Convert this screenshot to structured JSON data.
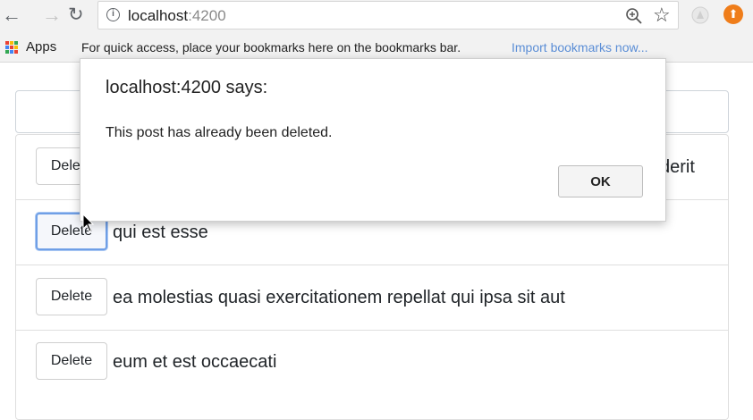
{
  "browser": {
    "url_host": "localhost",
    "url_port": ":4200",
    "apps_label": "Apps",
    "bookmarks_hint": "For quick access, place your bookmarks here on the bookmarks bar.",
    "import_link": "Import bookmarks now..."
  },
  "posts": [
    {
      "delete_label": "Delete",
      "title": "derit"
    },
    {
      "delete_label": "Delete",
      "title": "qui est esse"
    },
    {
      "delete_label": "Delete",
      "title": "ea molestias quasi exercitationem repellat qui ipsa sit aut"
    },
    {
      "delete_label": "Delete",
      "title": "eum et est occaecati"
    }
  ],
  "dialog": {
    "title": "localhost:4200 says:",
    "message": "This post has already been deleted.",
    "ok_label": "OK"
  },
  "colors": {
    "focus_ring": "#6f9fe6",
    "link": "#5b8ed6",
    "extension_orange": "#ef7d1a"
  }
}
